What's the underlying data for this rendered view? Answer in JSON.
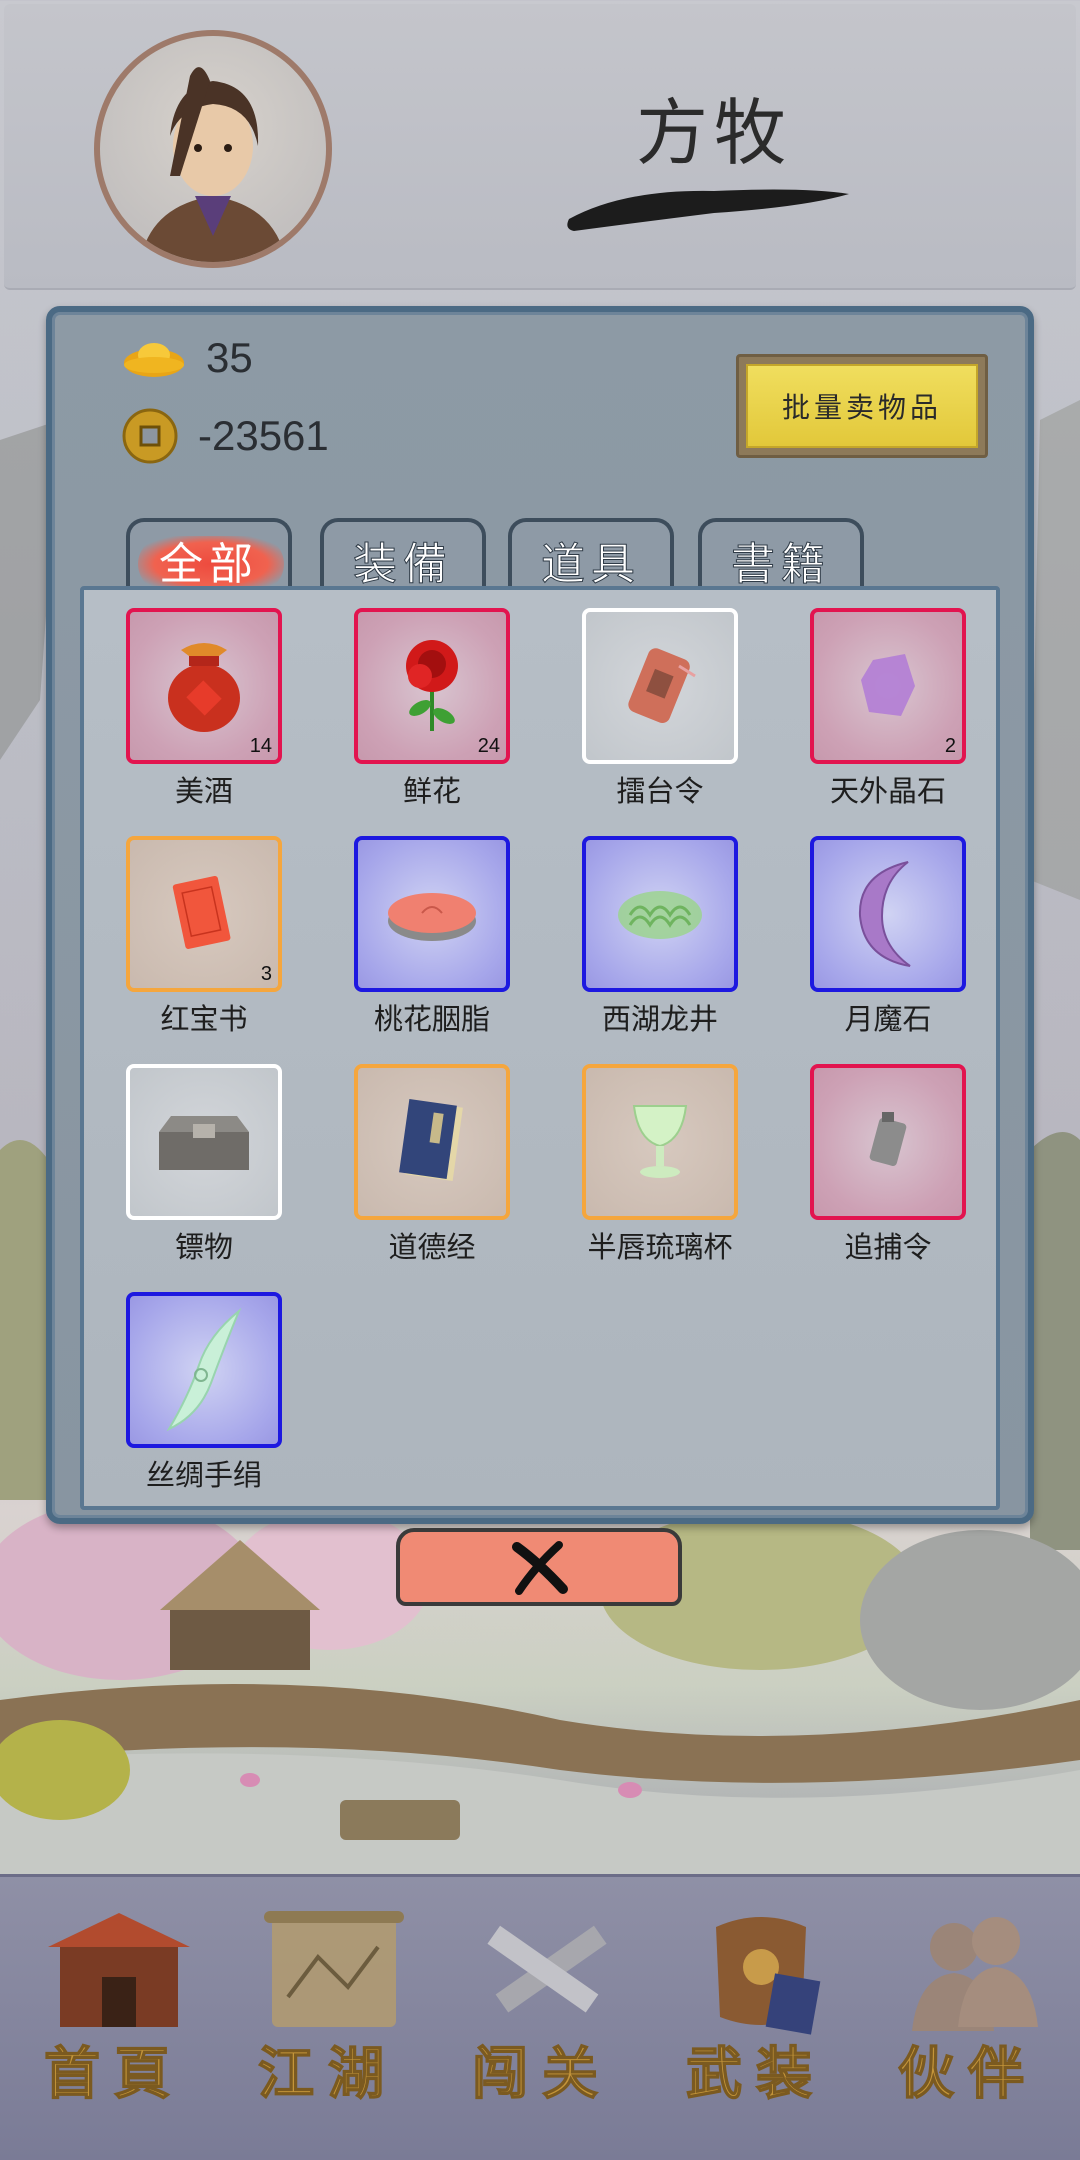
{
  "header": {
    "player_name": "方牧"
  },
  "currency": {
    "gold_ingot": "35",
    "copper_coin": "-23561"
  },
  "actions": {
    "bulk_sell_label": "批量卖物品"
  },
  "tabs": [
    {
      "label": "全部",
      "active": true
    },
    {
      "label": "装備",
      "active": false
    },
    {
      "label": "道具",
      "active": false
    },
    {
      "label": "書籍",
      "active": false
    }
  ],
  "items": [
    {
      "name": "美酒",
      "count": "14",
      "rarity": "red"
    },
    {
      "name": "鲜花",
      "count": "24",
      "rarity": "red"
    },
    {
      "name": "擂台令",
      "count": "",
      "rarity": "white"
    },
    {
      "name": "天外晶石",
      "count": "2",
      "rarity": "red"
    },
    {
      "name": "红宝书",
      "count": "3",
      "rarity": "orange"
    },
    {
      "name": "桃花胭脂",
      "count": "",
      "rarity": "blue"
    },
    {
      "name": "西湖龙井",
      "count": "",
      "rarity": "blue"
    },
    {
      "name": "月魔石",
      "count": "",
      "rarity": "blue"
    },
    {
      "name": "镖物",
      "count": "",
      "rarity": "white"
    },
    {
      "name": "道德经",
      "count": "",
      "rarity": "orange"
    },
    {
      "name": "半唇琉璃杯",
      "count": "",
      "rarity": "orange"
    },
    {
      "name": "追捕令",
      "count": "",
      "rarity": "red"
    },
    {
      "name": "丝绸手绢",
      "count": "",
      "rarity": "blue"
    }
  ],
  "bottom_nav": [
    {
      "label": "首頁",
      "icon": "house-icon"
    },
    {
      "label": "江湖",
      "icon": "scroll-icon"
    },
    {
      "label": "闯关",
      "icon": "crossed-swords-icon"
    },
    {
      "label": "武装",
      "icon": "armor-icon"
    },
    {
      "label": "伙伴",
      "icon": "companions-icon"
    }
  ],
  "colors": {
    "rarity_red": "#e2144f",
    "rarity_white": "#ffffff",
    "rarity_orange": "#f5a63d",
    "rarity_blue": "#1d18e0",
    "sell_button": "#e2c83a",
    "nav_text": "#c4953a"
  }
}
